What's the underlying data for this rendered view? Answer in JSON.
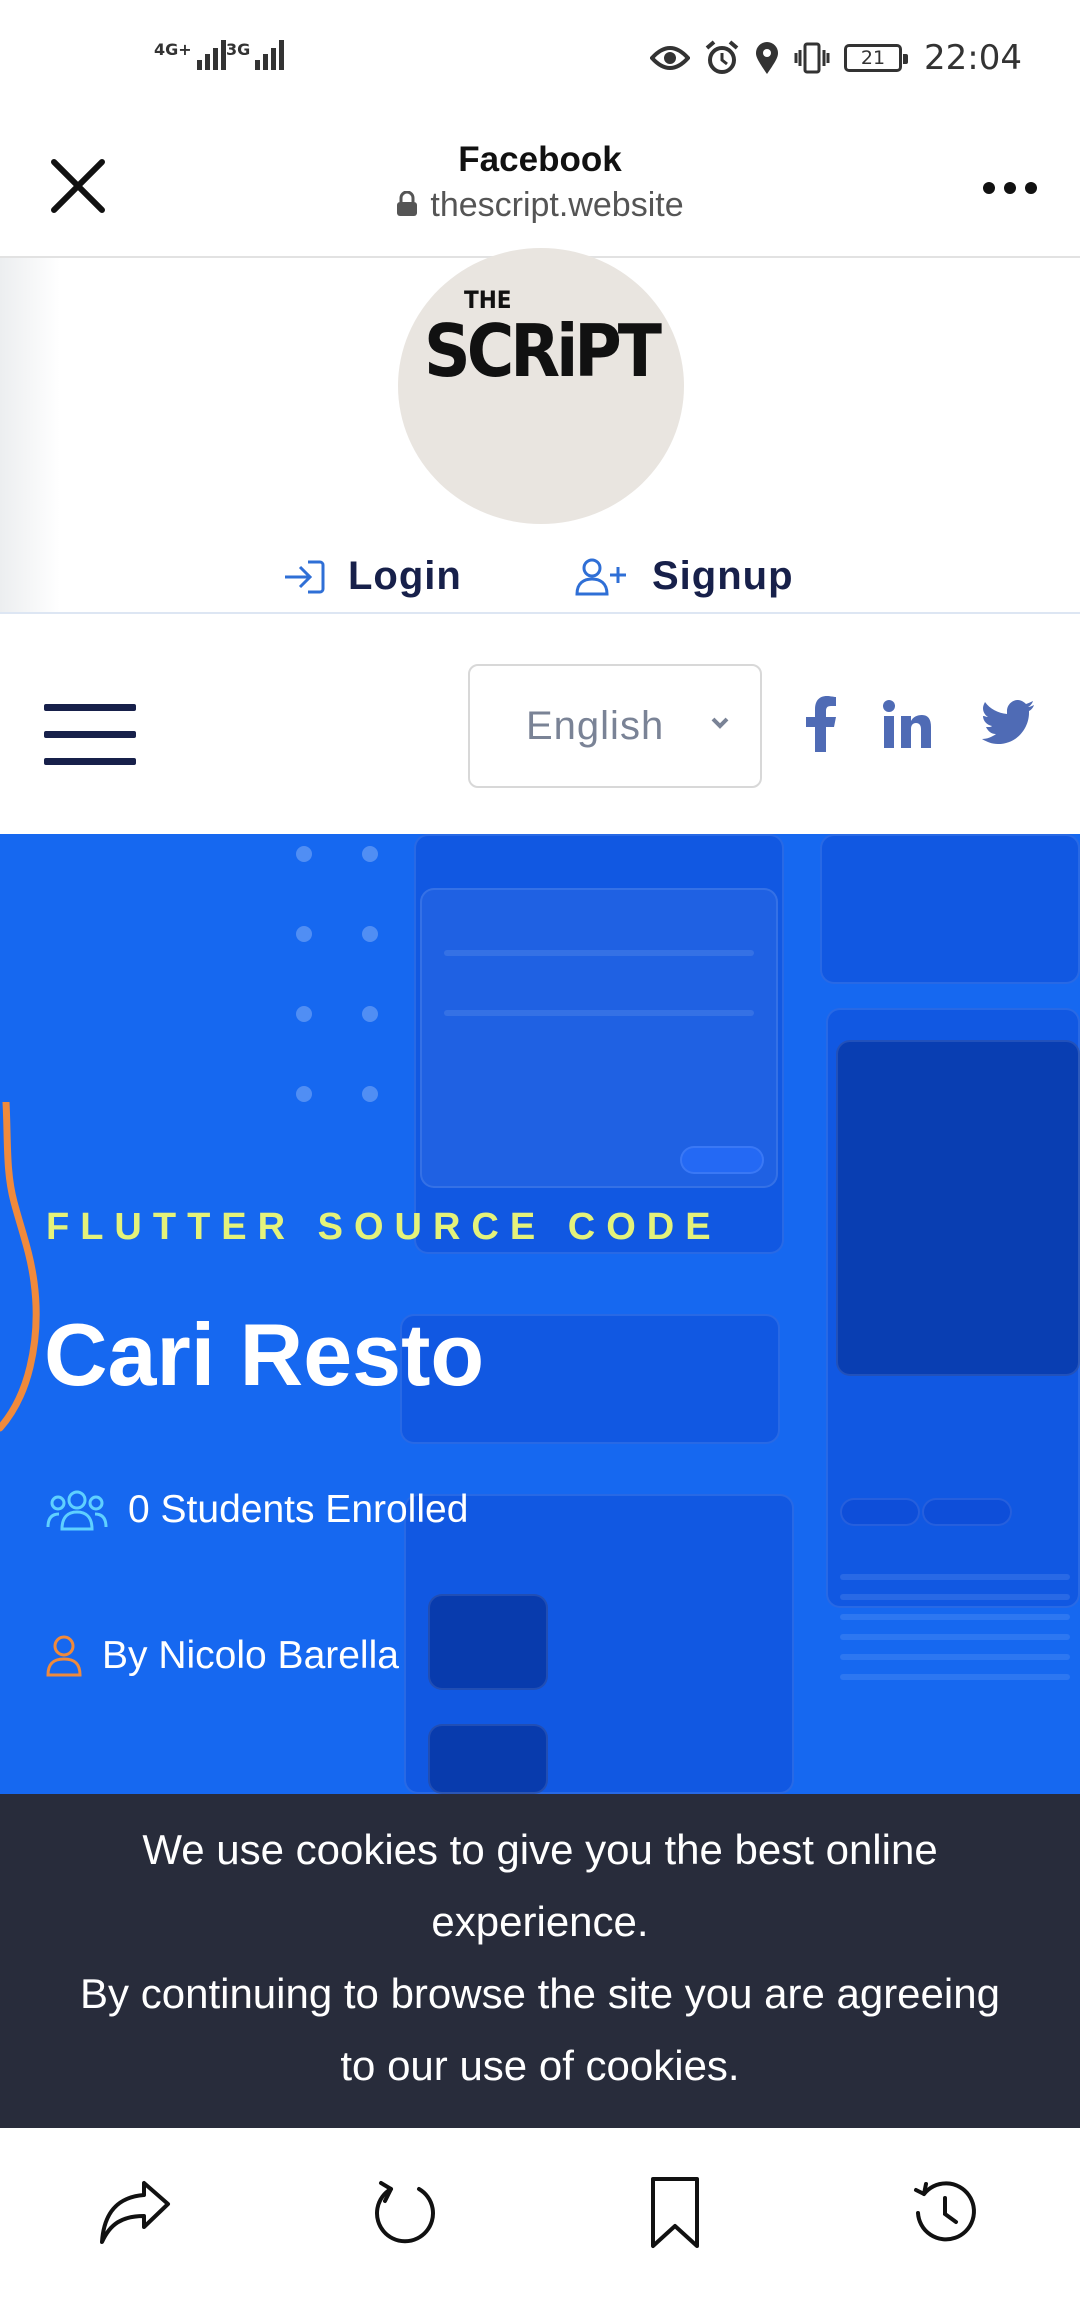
{
  "status_bar": {
    "network_1": "4G+",
    "network_2": "3G",
    "battery": "21",
    "time": "22:04"
  },
  "browser": {
    "title": "Facebook",
    "url": "thescript.website"
  },
  "site": {
    "logo_top": "THE",
    "logo_main": "SCRiPT",
    "login_label": "Login",
    "signup_label": "Signup",
    "language": "English",
    "social_icons": [
      "facebook-icon",
      "linkedin-icon",
      "twitter-icon"
    ]
  },
  "hero": {
    "subtitle": "FLUTTER SOURCE CODE",
    "title": "Cari Resto",
    "students": "0 Students Enrolled",
    "author": "By Nicolo Barella",
    "colors": {
      "background": "#1668f0",
      "subtitle": "#e4f27a",
      "icon": "#5fd0ff",
      "accent": "#f08a3c"
    }
  },
  "cookie": {
    "line1": "We use cookies to give you the best online experience.",
    "line2": "By continuing to browse the site you are agreeing to our use of cookies."
  },
  "toolbar": {
    "icons": [
      "share-icon",
      "refresh-icon",
      "bookmark-icon",
      "history-icon"
    ]
  }
}
